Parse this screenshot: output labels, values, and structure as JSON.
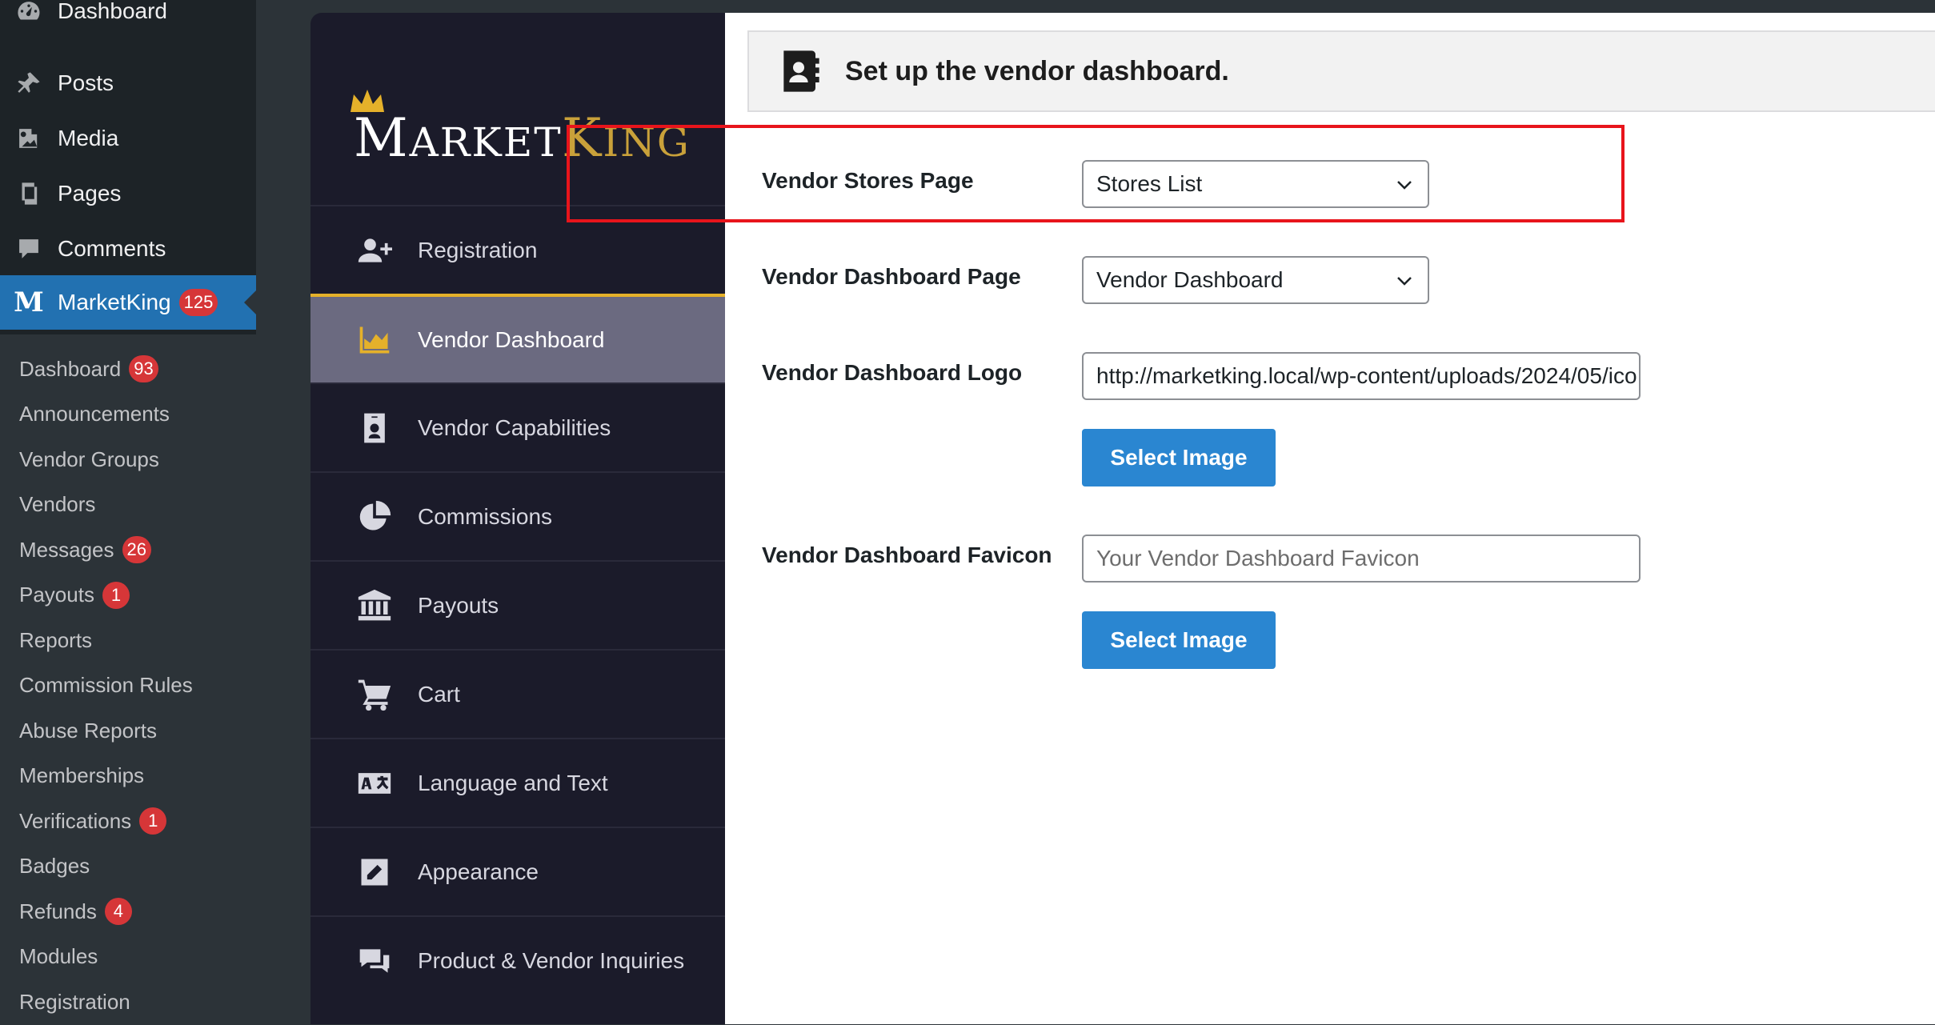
{
  "wp_menu": {
    "top_items": [
      {
        "label": "Dashboard",
        "icon": "dashboard-icon"
      },
      {
        "label": "Posts",
        "icon": "pin-icon"
      },
      {
        "label": "Media",
        "icon": "media-icon"
      },
      {
        "label": "Pages",
        "icon": "pages-icon"
      },
      {
        "label": "Comments",
        "icon": "comment-icon"
      },
      {
        "label": "MarketKing",
        "icon": "marketking-icon",
        "badge": "125"
      }
    ],
    "sub_items": [
      {
        "label": "Dashboard",
        "badge": "93"
      },
      {
        "label": "Announcements"
      },
      {
        "label": "Vendor Groups"
      },
      {
        "label": "Vendors"
      },
      {
        "label": "Messages",
        "badge": "26"
      },
      {
        "label": "Payouts",
        "badge": "1"
      },
      {
        "label": "Reports"
      },
      {
        "label": "Commission Rules"
      },
      {
        "label": "Abuse Reports"
      },
      {
        "label": "Memberships"
      },
      {
        "label": "Verifications",
        "badge": "1"
      },
      {
        "label": "Badges"
      },
      {
        "label": "Refunds",
        "badge": "4"
      },
      {
        "label": "Modules"
      },
      {
        "label": "Registration"
      }
    ]
  },
  "plugin": {
    "logo": {
      "market_first": "M",
      "market_rest": "ARKET",
      "king_first": "K",
      "king_rest": "ING"
    },
    "nav": [
      {
        "label": "Registration",
        "icon": "user-plus-icon"
      },
      {
        "label": "Vendor Dashboard",
        "icon": "area-chart-icon",
        "active": true
      },
      {
        "label": "Vendor Capabilities",
        "icon": "id-badge-icon"
      },
      {
        "label": "Commissions",
        "icon": "pie-chart-icon"
      },
      {
        "label": "Payouts",
        "icon": "bank-icon"
      },
      {
        "label": "Cart",
        "icon": "cart-icon"
      },
      {
        "label": "Language and Text",
        "icon": "language-icon"
      },
      {
        "label": "Appearance",
        "icon": "edit-icon"
      },
      {
        "label": "Product & Vendor Inquiries",
        "icon": "comments-icon"
      }
    ]
  },
  "content": {
    "header_title": "Set up the vendor dashboard.",
    "fields": {
      "stores_page": {
        "label": "Vendor Stores Page",
        "value": "Stores List"
      },
      "dashboard_page": {
        "label": "Vendor Dashboard Page",
        "value": "Vendor Dashboard"
      },
      "logo": {
        "label": "Vendor Dashboard Logo",
        "value": "http://marketking.local/wp-content/uploads/2024/05/ico"
      },
      "favicon": {
        "label": "Vendor Dashboard Favicon",
        "placeholder": "Your Vendor Dashboard Favicon"
      }
    },
    "select_image_label": "Select Image"
  },
  "colors": {
    "wp_accent": "#2271b1",
    "gold": "#e5b12a",
    "button_blue": "#2a86d1",
    "highlight_red": "#e8141b"
  }
}
